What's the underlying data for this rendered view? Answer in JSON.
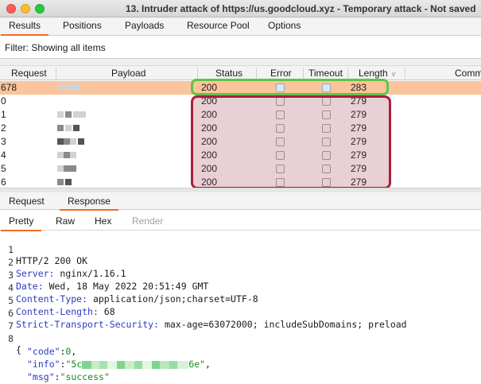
{
  "window": {
    "title": "13. Intruder attack of https://us.goodcloud.xyz - Temporary attack - Not saved"
  },
  "tabs": [
    "Results",
    "Positions",
    "Payloads",
    "Resource Pool",
    "Options"
  ],
  "filter": {
    "text": "Filter: Showing all items"
  },
  "table": {
    "columns": [
      "Request",
      "Payload",
      "Status",
      "Error",
      "Timeout",
      "Length",
      "Comment"
    ],
    "rows": [
      {
        "request": "678",
        "status": "200",
        "length": "283"
      },
      {
        "request": "0",
        "status": "200",
        "length": "279"
      },
      {
        "request": "1",
        "status": "200",
        "length": "279"
      },
      {
        "request": "2",
        "status": "200",
        "length": "279"
      },
      {
        "request": "3",
        "status": "200",
        "length": "279"
      },
      {
        "request": "4",
        "status": "200",
        "length": "279"
      },
      {
        "request": "5",
        "status": "200",
        "length": "279"
      },
      {
        "request": "6",
        "status": "200",
        "length": "279"
      }
    ]
  },
  "panel_tabs": [
    "Request",
    "Response"
  ],
  "view_tabs": [
    "Pretty",
    "Raw",
    "Hex",
    "Render"
  ],
  "response": {
    "status_line": "HTTP/2 200 OK",
    "headers": [
      {
        "key": "Server",
        "value": "nginx/1.16.1"
      },
      {
        "key": "Date",
        "value": "Wed, 18 May 2022 20:51:49 GMT"
      },
      {
        "key": "Content-Type",
        "value": "application/json;charset=UTF-8"
      },
      {
        "key": "Content-Length",
        "value": "68"
      },
      {
        "key": "Strict-Transport-Security",
        "value": "max-age=63072000; includeSubDomains; preload"
      }
    ],
    "line_numbers": [
      "1",
      "2",
      "3",
      "4",
      "5",
      "6",
      "7",
      "8"
    ],
    "body_open": "{",
    "body_close": "}",
    "json": {
      "code_key": "\"code\"",
      "code_val": "0",
      "info_key": "\"info\"",
      "info_prefix": "\"5c",
      "info_suffix": "6e\"",
      "msg_key": "\"msg\"",
      "msg_val": "\"success\""
    }
  },
  "colors": {
    "accent": "#f26b21",
    "highlight_row": "#fbc49c",
    "green_box": "#5fc545",
    "red_box": "#a8203a"
  }
}
